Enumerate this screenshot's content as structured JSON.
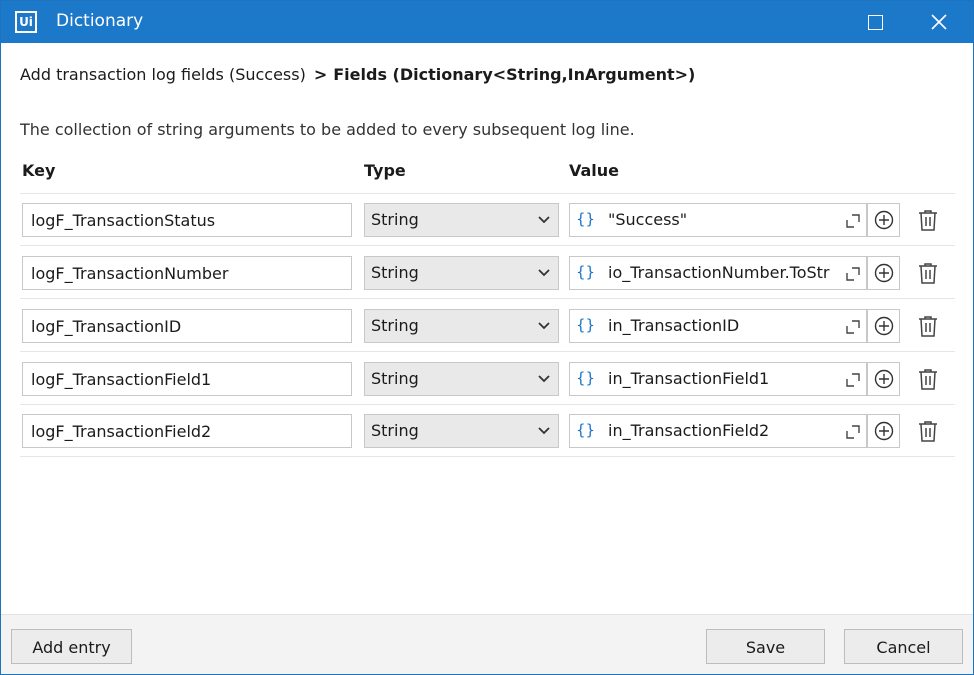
{
  "window": {
    "app_logo": "Ui",
    "title": "Dictionary"
  },
  "breadcrumb": {
    "parent": "Add transaction log fields (Success)",
    "separator": ">",
    "current": "Fields (Dictionary<String,InArgument>)"
  },
  "description": "The collection of string arguments to be added to every subsequent log line.",
  "columns": {
    "key": "Key",
    "type": "Type",
    "value": "Value"
  },
  "entries": [
    {
      "key": "logF_TransactionStatus",
      "type": "String",
      "value": "\"Success\""
    },
    {
      "key": "logF_TransactionNumber",
      "type": "String",
      "value": "io_TransactionNumber.ToString"
    },
    {
      "key": "logF_TransactionID",
      "type": "String",
      "value": "in_TransactionID"
    },
    {
      "key": "logF_TransactionField1",
      "type": "String",
      "value": "in_TransactionField1"
    },
    {
      "key": "logF_TransactionField2",
      "type": "String",
      "value": "in_TransactionField2"
    }
  ],
  "icons": {
    "expression": "{}",
    "expand": "expand-icon",
    "add": "plus-circle-icon",
    "delete": "trash-icon"
  },
  "footer": {
    "add_entry": "Add entry",
    "save": "Save",
    "cancel": "Cancel"
  },
  "colors": {
    "titlebar": "#1c78c8",
    "accent": "#1a73c8"
  }
}
